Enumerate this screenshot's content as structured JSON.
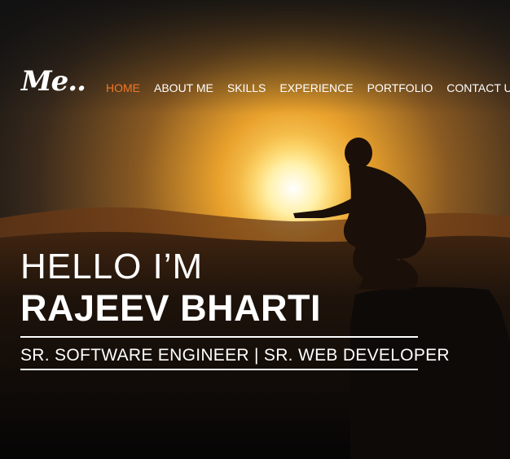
{
  "brand": {
    "logo_text": "Me.."
  },
  "nav": {
    "items": [
      {
        "label": "HOME",
        "active": true
      },
      {
        "label": "ABOUT ME",
        "active": false
      },
      {
        "label": "SKILLS",
        "active": false
      },
      {
        "label": "EXPERIENCE",
        "active": false
      },
      {
        "label": "PORTFOLIO",
        "active": false
      },
      {
        "label": "CONTACT US",
        "active": false
      }
    ],
    "active_color": "#f0772a"
  },
  "hero": {
    "greeting": "HELLO I’M",
    "name": "RAJEEV BHARTI",
    "tagline": "SR. SOFTWARE ENGINEER | SR. WEB DEVELOPER",
    "background": "sunset-silhouette-photo"
  }
}
